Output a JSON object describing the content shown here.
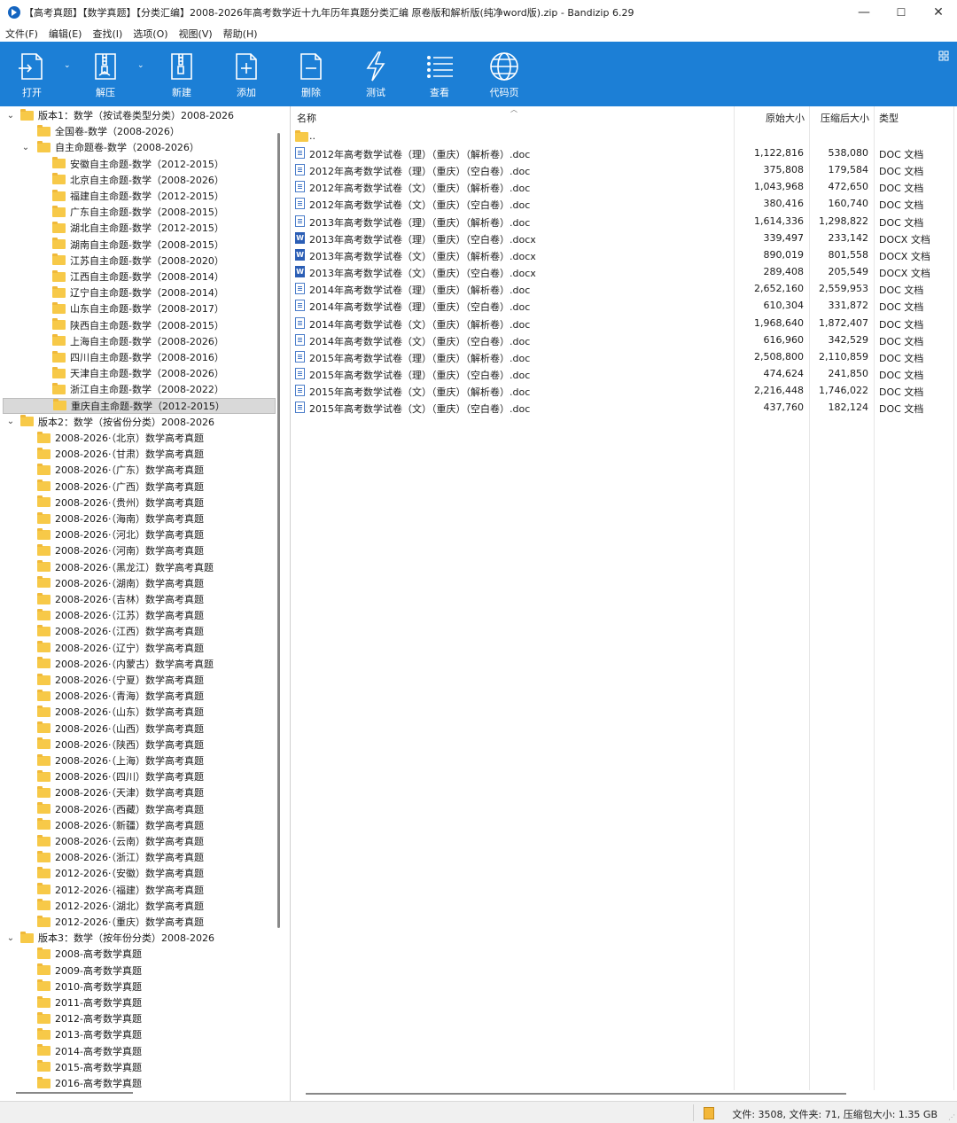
{
  "window": {
    "title": "【高考真题】【数学真题】【分类汇编】2008-2026年高考数学近十九年历年真题分类汇编  原卷版和解析版(纯净word版).zip - Bandizip 6.29",
    "minimize": "—",
    "maximize": "☐",
    "close": "✕"
  },
  "menu": [
    "文件(F)",
    "编辑(E)",
    "查找(I)",
    "选项(O)",
    "视图(V)",
    "帮助(H)"
  ],
  "toolbar": {
    "open": "打开",
    "extract": "解压",
    "new": "新建",
    "add": "添加",
    "delete": "删除",
    "test": "测试",
    "view": "查看",
    "codepage": "代码页",
    "dropdown": "⌄",
    "background": "#1c7fd6"
  },
  "tree": [
    {
      "label": "版本1：数学（按试卷类型分类）2008-2026",
      "level": 0,
      "expander": "⌄"
    },
    {
      "label": "全国卷-数学（2008-2026）",
      "level": 1,
      "expander": ""
    },
    {
      "label": "自主命题卷-数学（2008-2026）",
      "level": 1,
      "expander": "⌄"
    },
    {
      "label": "安徽自主命题-数学（2012-2015）",
      "level": 2,
      "expander": ""
    },
    {
      "label": "北京自主命题-数学（2008-2026）",
      "level": 2,
      "expander": ""
    },
    {
      "label": "福建自主命题-数学（2012-2015）",
      "level": 2,
      "expander": ""
    },
    {
      "label": "广东自主命题-数学（2008-2015）",
      "level": 2,
      "expander": ""
    },
    {
      "label": "湖北自主命题-数学（2012-2015）",
      "level": 2,
      "expander": ""
    },
    {
      "label": "湖南自主命题-数学（2008-2015）",
      "level": 2,
      "expander": ""
    },
    {
      "label": "江苏自主命题-数学（2008-2020）",
      "level": 2,
      "expander": ""
    },
    {
      "label": "江西自主命题-数学（2008-2014）",
      "level": 2,
      "expander": ""
    },
    {
      "label": "辽宁自主命题-数学（2008-2014）",
      "level": 2,
      "expander": ""
    },
    {
      "label": "山东自主命题-数学（2008-2017）",
      "level": 2,
      "expander": ""
    },
    {
      "label": "陕西自主命题-数学（2008-2015）",
      "level": 2,
      "expander": ""
    },
    {
      "label": "上海自主命题-数学（2008-2026）",
      "level": 2,
      "expander": ""
    },
    {
      "label": "四川自主命题-数学（2008-2016）",
      "level": 2,
      "expander": ""
    },
    {
      "label": "天津自主命题-数学（2008-2026）",
      "level": 2,
      "expander": ""
    },
    {
      "label": "浙江自主命题-数学（2008-2022）",
      "level": 2,
      "expander": ""
    },
    {
      "label": "重庆自主命题-数学（2012-2015）",
      "level": 2,
      "expander": "",
      "selected": true
    },
    {
      "label": "版本2：数学（按省份分类）2008-2026",
      "level": 0,
      "expander": "⌄"
    },
    {
      "label": "2008-2026·（北京）数学高考真题",
      "level": 1,
      "expander": ""
    },
    {
      "label": "2008-2026·（甘肃）数学高考真题",
      "level": 1,
      "expander": ""
    },
    {
      "label": "2008-2026·（广东）数学高考真题",
      "level": 1,
      "expander": ""
    },
    {
      "label": "2008-2026·（广西）数学高考真题",
      "level": 1,
      "expander": ""
    },
    {
      "label": "2008-2026·（贵州）数学高考真题",
      "level": 1,
      "expander": ""
    },
    {
      "label": "2008-2026·（海南）数学高考真题",
      "level": 1,
      "expander": ""
    },
    {
      "label": "2008-2026·（河北）数学高考真题",
      "level": 1,
      "expander": ""
    },
    {
      "label": "2008-2026·（河南）数学高考真题",
      "level": 1,
      "expander": ""
    },
    {
      "label": "2008-2026·（黑龙江）数学高考真题",
      "level": 1,
      "expander": ""
    },
    {
      "label": "2008-2026·（湖南）数学高考真题",
      "level": 1,
      "expander": ""
    },
    {
      "label": "2008-2026·（吉林）数学高考真题",
      "level": 1,
      "expander": ""
    },
    {
      "label": "2008-2026·（江苏）数学高考真题",
      "level": 1,
      "expander": ""
    },
    {
      "label": "2008-2026·（江西）数学高考真题",
      "level": 1,
      "expander": ""
    },
    {
      "label": "2008-2026·（辽宁）数学高考真题",
      "level": 1,
      "expander": ""
    },
    {
      "label": "2008-2026·（内蒙古）数学高考真题",
      "level": 1,
      "expander": ""
    },
    {
      "label": "2008-2026·（宁夏）数学高考真题",
      "level": 1,
      "expander": ""
    },
    {
      "label": "2008-2026·（青海）数学高考真题",
      "level": 1,
      "expander": ""
    },
    {
      "label": "2008-2026·（山东）数学高考真题",
      "level": 1,
      "expander": ""
    },
    {
      "label": "2008-2026·（山西）数学高考真题",
      "level": 1,
      "expander": ""
    },
    {
      "label": "2008-2026·（陕西）数学高考真题",
      "level": 1,
      "expander": ""
    },
    {
      "label": "2008-2026·（上海）数学高考真题",
      "level": 1,
      "expander": ""
    },
    {
      "label": "2008-2026·（四川）数学高考真题",
      "level": 1,
      "expander": ""
    },
    {
      "label": "2008-2026·（天津）数学高考真题",
      "level": 1,
      "expander": ""
    },
    {
      "label": "2008-2026·（西藏）数学高考真题",
      "level": 1,
      "expander": ""
    },
    {
      "label": "2008-2026·（新疆）数学高考真题",
      "level": 1,
      "expander": ""
    },
    {
      "label": "2008-2026·（云南）数学高考真题",
      "level": 1,
      "expander": ""
    },
    {
      "label": "2008-2026·（浙江）数学高考真题",
      "level": 1,
      "expander": ""
    },
    {
      "label": "2012-2026·（安徽）数学高考真题",
      "level": 1,
      "expander": ""
    },
    {
      "label": "2012-2026·（福建）数学高考真题",
      "level": 1,
      "expander": ""
    },
    {
      "label": "2012-2026·（湖北）数学高考真题",
      "level": 1,
      "expander": ""
    },
    {
      "label": "2012-2026·（重庆）数学高考真题",
      "level": 1,
      "expander": ""
    },
    {
      "label": "版本3：数学（按年份分类）2008-2026",
      "level": 0,
      "expander": "⌄"
    },
    {
      "label": "2008-高考数学真题",
      "level": 1,
      "expander": ""
    },
    {
      "label": "2009-高考数学真题",
      "level": 1,
      "expander": ""
    },
    {
      "label": "2010-高考数学真题",
      "level": 1,
      "expander": ""
    },
    {
      "label": "2011-高考数学真题",
      "level": 1,
      "expander": ""
    },
    {
      "label": "2012-高考数学真题",
      "level": 1,
      "expander": ""
    },
    {
      "label": "2013-高考数学真题",
      "level": 1,
      "expander": ""
    },
    {
      "label": "2014-高考数学真题",
      "level": 1,
      "expander": ""
    },
    {
      "label": "2015-高考数学真题",
      "level": 1,
      "expander": ""
    },
    {
      "label": "2016-高考数学真题",
      "level": 1,
      "expander": ""
    }
  ],
  "filelist": {
    "columns": {
      "name": "名称",
      "original_size": "原始大小",
      "compressed_size": "压缩后大小",
      "type": "类型"
    },
    "parent": "..",
    "rows": [
      {
        "name": "2012年高考数学试卷（理）（重庆）（解析卷）.doc",
        "size": "1,122,816",
        "packed": "538,080",
        "type": "DOC 文档",
        "icon": "doc"
      },
      {
        "name": "2012年高考数学试卷（理）（重庆）（空白卷）.doc",
        "size": "375,808",
        "packed": "179,584",
        "type": "DOC 文档",
        "icon": "doc"
      },
      {
        "name": "2012年高考数学试卷（文）（重庆）（解析卷）.doc",
        "size": "1,043,968",
        "packed": "472,650",
        "type": "DOC 文档",
        "icon": "doc"
      },
      {
        "name": "2012年高考数学试卷（文）（重庆）（空白卷）.doc",
        "size": "380,416",
        "packed": "160,740",
        "type": "DOC 文档",
        "icon": "doc"
      },
      {
        "name": "2013年高考数学试卷（理）（重庆）（解析卷）.doc",
        "size": "1,614,336",
        "packed": "1,298,822",
        "type": "DOC 文档",
        "icon": "doc"
      },
      {
        "name": "2013年高考数学试卷（理）（重庆）（空白卷）.docx",
        "size": "339,497",
        "packed": "233,142",
        "type": "DOCX 文档",
        "icon": "docx"
      },
      {
        "name": "2013年高考数学试卷（文）（重庆）（解析卷）.docx",
        "size": "890,019",
        "packed": "801,558",
        "type": "DOCX 文档",
        "icon": "docx"
      },
      {
        "name": "2013年高考数学试卷（文）（重庆）（空白卷）.docx",
        "size": "289,408",
        "packed": "205,549",
        "type": "DOCX 文档",
        "icon": "docx"
      },
      {
        "name": "2014年高考数学试卷（理）（重庆）（解析卷）.doc",
        "size": "2,652,160",
        "packed": "2,559,953",
        "type": "DOC 文档",
        "icon": "doc"
      },
      {
        "name": "2014年高考数学试卷（理）（重庆）（空白卷）.doc",
        "size": "610,304",
        "packed": "331,872",
        "type": "DOC 文档",
        "icon": "doc"
      },
      {
        "name": "2014年高考数学试卷（文）（重庆）（解析卷）.doc",
        "size": "1,968,640",
        "packed": "1,872,407",
        "type": "DOC 文档",
        "icon": "doc"
      },
      {
        "name": "2014年高考数学试卷（文）（重庆）（空白卷）.doc",
        "size": "616,960",
        "packed": "342,529",
        "type": "DOC 文档",
        "icon": "doc"
      },
      {
        "name": "2015年高考数学试卷（理）（重庆）（解析卷）.doc",
        "size": "2,508,800",
        "packed": "2,110,859",
        "type": "DOC 文档",
        "icon": "doc"
      },
      {
        "name": "2015年高考数学试卷（理）（重庆）（空白卷）.doc",
        "size": "474,624",
        "packed": "241,850",
        "type": "DOC 文档",
        "icon": "doc"
      },
      {
        "name": "2015年高考数学试卷（文）（重庆）（解析卷）.doc",
        "size": "2,216,448",
        "packed": "1,746,022",
        "type": "DOC 文档",
        "icon": "doc"
      },
      {
        "name": "2015年高考数学试卷（文）（重庆）（空白卷）.doc",
        "size": "437,760",
        "packed": "182,124",
        "type": "DOC 文档",
        "icon": "doc"
      }
    ]
  },
  "status": {
    "text": "文件: 3508, 文件夹: 71, 压缩包大小: 1.35 GB",
    "grip": "⋰"
  }
}
